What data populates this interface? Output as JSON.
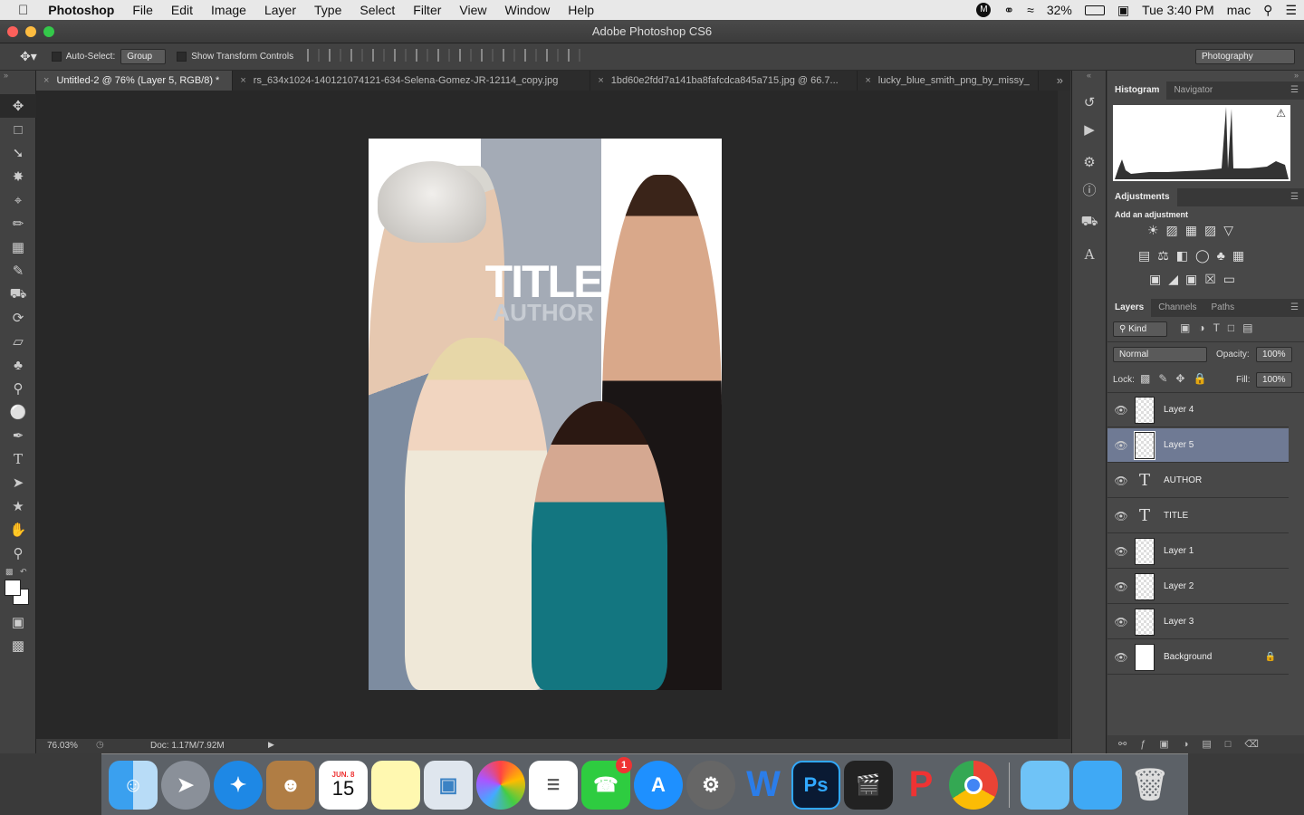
{
  "menubar": {
    "app_name": "Photoshop",
    "items": [
      "File",
      "Edit",
      "Image",
      "Layer",
      "Type",
      "Select",
      "Filter",
      "View",
      "Window",
      "Help"
    ],
    "battery": "32%",
    "clock": "Tue 3:40 PM",
    "user": "mac"
  },
  "window": {
    "title": "Adobe Photoshop CS6"
  },
  "options": {
    "auto_select_label": "Auto-Select:",
    "auto_select_value": "Group",
    "transform_label": "Show Transform Controls",
    "workspace": "Photography"
  },
  "tabs": [
    {
      "label": "Untitled-2 @ 76% (Layer 5, RGB/8) *"
    },
    {
      "label": "rs_634x1024-140121074121-634-Selena-Gomez-JR-12114_copy.jpg"
    },
    {
      "label": "1bd60e2fdd7a141ba8fafcdca845a715.jpg @ 66.7..."
    },
    {
      "label": "lucky_blue_smith_png_by_missy_"
    }
  ],
  "canvas": {
    "title_text": "TITLE",
    "author_text": "AUTHOR"
  },
  "status": {
    "zoom": "76.03%",
    "doc": "Doc: 1.17M/7.92M"
  },
  "histogram": {
    "tabs": [
      "Histogram",
      "Navigator"
    ]
  },
  "adjustments": {
    "tab": "Adjustments",
    "hint": "Add an adjustment"
  },
  "layers_panel": {
    "tabs": [
      "Layers",
      "Channels",
      "Paths"
    ],
    "kind": "Kind",
    "blend": "Normal",
    "opacity_label": "Opacity:",
    "opacity": "100%",
    "lock_label": "Lock:",
    "fill_label": "Fill:",
    "fill": "100%",
    "layers": [
      {
        "name": "Layer 4",
        "type": "image",
        "selected": false
      },
      {
        "name": "Layer 5",
        "type": "image",
        "selected": true
      },
      {
        "name": "AUTHOR",
        "type": "text",
        "selected": false
      },
      {
        "name": "TITLE",
        "type": "text",
        "selected": false
      },
      {
        "name": "Layer 1",
        "type": "image",
        "selected": false
      },
      {
        "name": "Layer 2",
        "type": "image",
        "selected": false
      },
      {
        "name": "Layer 3",
        "type": "image",
        "selected": false
      },
      {
        "name": "Background",
        "type": "background",
        "selected": false
      }
    ]
  },
  "dock": {
    "apps": [
      "Finder",
      "Launchpad",
      "Safari",
      "Contacts",
      "Calendar",
      "Notes",
      "Preview",
      "Photos",
      "Reminders",
      "FaceTime",
      "App Store",
      "System Preferences",
      "Word",
      "Photoshop",
      "Final Cut Pro",
      "Polarr",
      "Chrome",
      "Folder",
      "Downloads",
      "Trash"
    ],
    "calendar_month": "JUN. 8",
    "calendar_day": "15",
    "facetime_badge": "1"
  },
  "colors": {
    "accent_selected": "#6f7a94",
    "panel_bg": "#484848",
    "canvas_bg": "#282828"
  }
}
